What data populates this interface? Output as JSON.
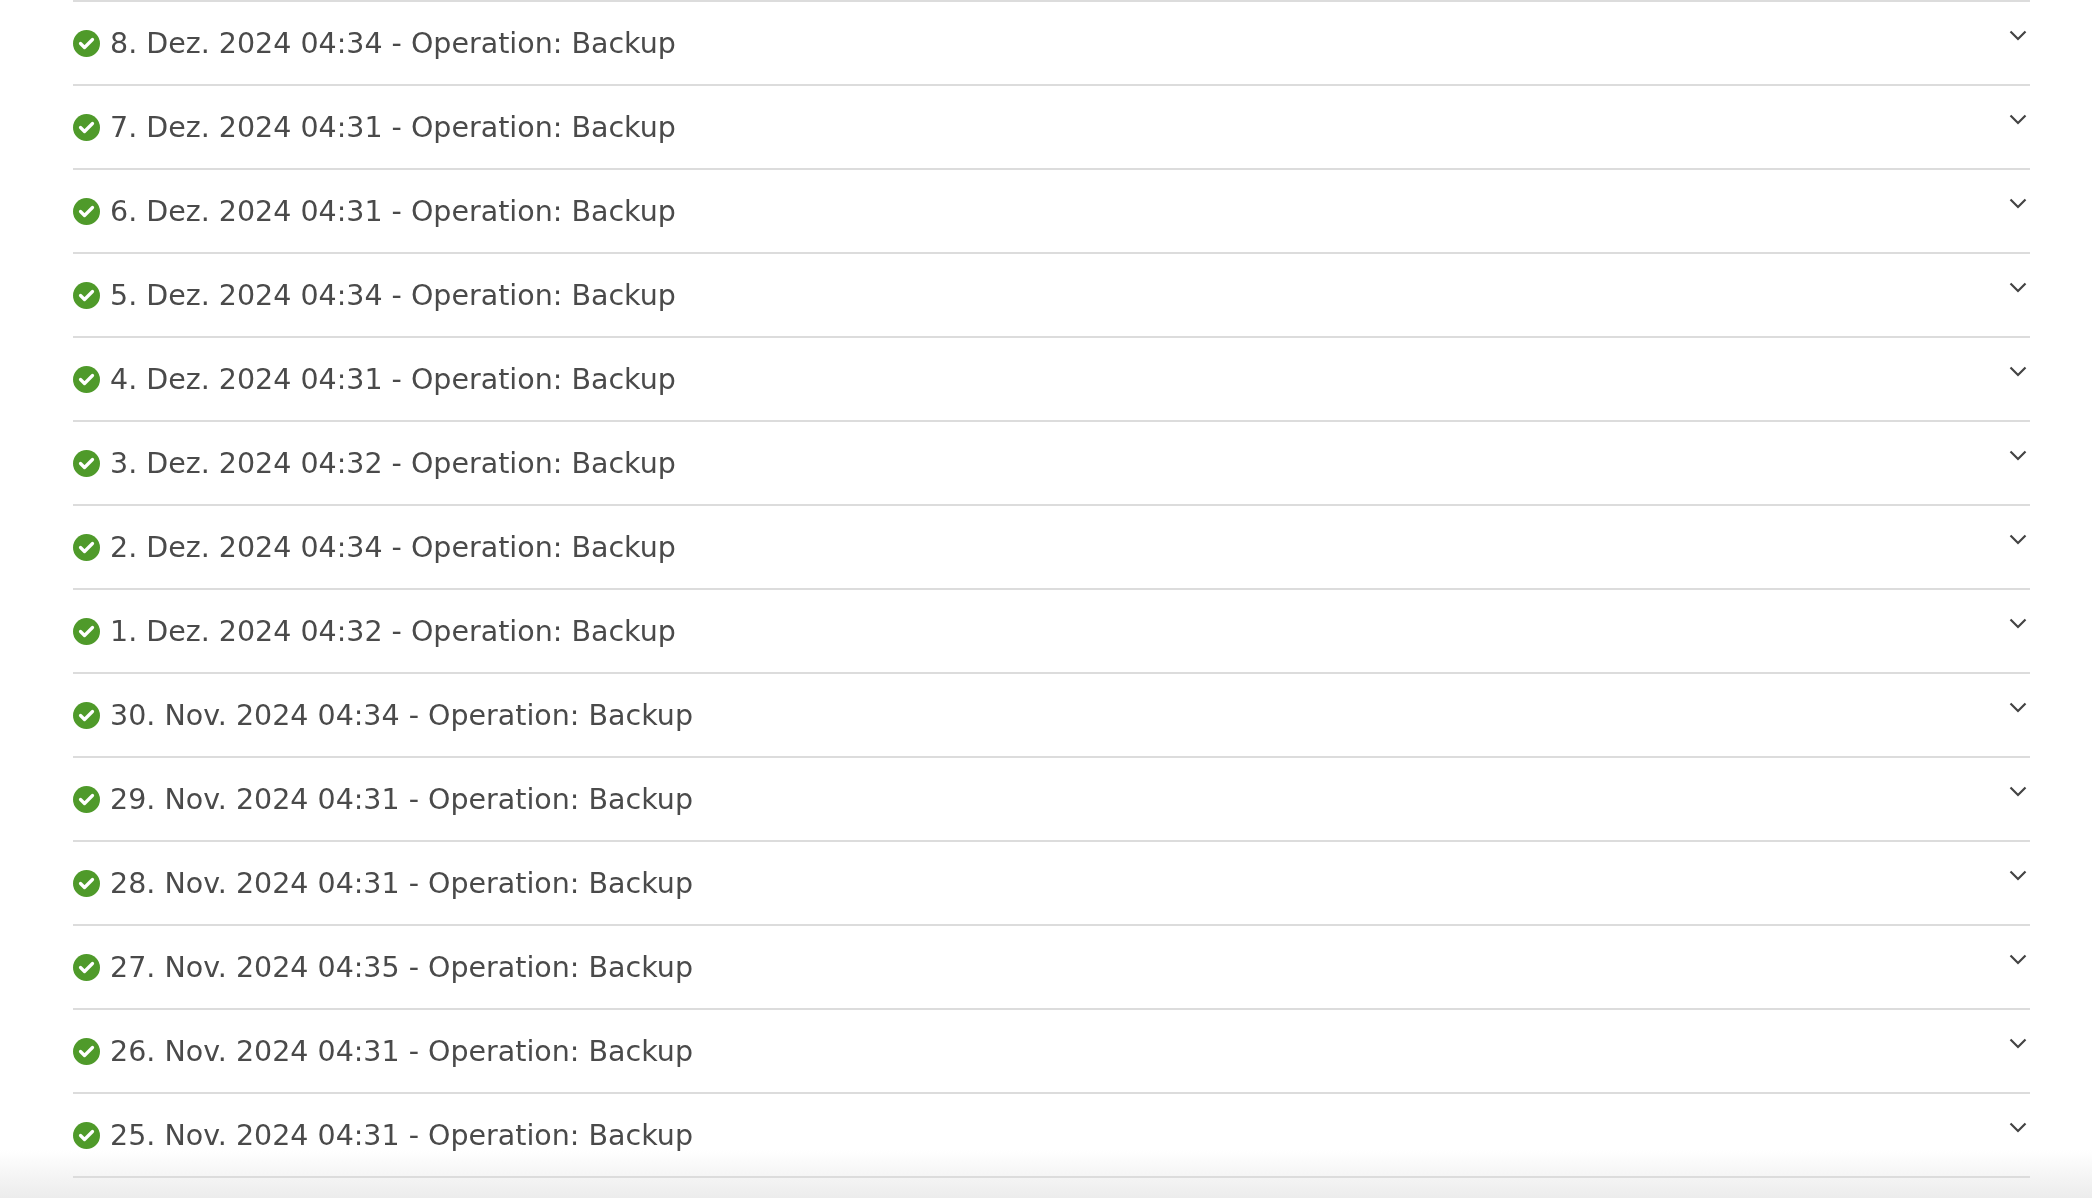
{
  "entries": [
    {
      "label": "8. Dez. 2024 04:34 - Operation: Backup",
      "kind": "success",
      "expanded": false
    },
    {
      "label": "7. Dez. 2024 04:31 - Operation: Backup",
      "kind": "success",
      "expanded": false
    },
    {
      "label": "6. Dez. 2024 04:31 - Operation: Backup",
      "kind": "success",
      "expanded": false
    },
    {
      "label": "5. Dez. 2024 04:34 - Operation: Backup",
      "kind": "success",
      "expanded": false
    },
    {
      "label": "4. Dez. 2024 04:31 - Operation: Backup",
      "kind": "success",
      "expanded": false
    },
    {
      "label": "3. Dez. 2024 04:32 - Operation: Backup",
      "kind": "success",
      "expanded": false
    },
    {
      "label": "2. Dez. 2024 04:34 - Operation: Backup",
      "kind": "success",
      "expanded": false
    },
    {
      "label": "1. Dez. 2024 04:32 - Operation: Backup",
      "kind": "success",
      "expanded": false
    },
    {
      "label": "30. Nov. 2024 04:34 - Operation: Backup",
      "kind": "success",
      "expanded": false
    },
    {
      "label": "29. Nov. 2024 04:31 - Operation: Backup",
      "kind": "success",
      "expanded": false
    },
    {
      "label": "28. Nov. 2024 04:31 - Operation: Backup",
      "kind": "success",
      "expanded": false
    },
    {
      "label": "27. Nov. 2024 04:35 - Operation: Backup",
      "kind": "success",
      "expanded": false
    },
    {
      "label": "26. Nov. 2024 04:31 - Operation: Backup",
      "kind": "success",
      "expanded": false
    },
    {
      "label": "25. Nov. 2024 04:31 - Operation: Backup",
      "kind": "success",
      "expanded": false
    }
  ]
}
